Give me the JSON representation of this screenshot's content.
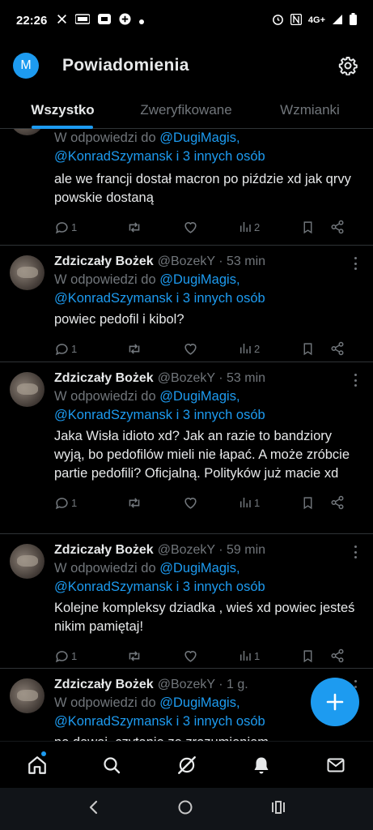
{
  "status_bar": {
    "time": "22:26",
    "left_icons": [
      "x-icon",
      "vodafone-icon",
      "app-icon",
      "game-icon",
      "dot-icon"
    ],
    "network": "4G+"
  },
  "header": {
    "avatar_letter": "M",
    "title": "Powiadomienia"
  },
  "tabs": [
    {
      "label": "Wszystko",
      "active": true
    },
    {
      "label": "Zweryfikowane",
      "active": false
    },
    {
      "label": "Wzmianki",
      "active": false
    }
  ],
  "posts": [
    {
      "name": "",
      "handle": "",
      "time": "",
      "reply_prefix": "W odpowiedzi do",
      "mention1": "@DugiMagis,",
      "mention2": "@KonradSzymansk i 3 innych osób",
      "text": "ale we francji dostał macron po piździe xd jak qrvy powskie dostaną",
      "replies": "1",
      "retweets": "",
      "likes": "",
      "views": "2"
    },
    {
      "name": "Zdziczały Bożek",
      "handle": "@BozekY · 53 min",
      "reply_prefix": "W odpowiedzi do",
      "mention1": "@DugiMagis,",
      "mention2": "@KonradSzymansk i 3 innych osób",
      "text": "powiec pedofil i kibol?",
      "replies": "1",
      "retweets": "",
      "likes": "",
      "views": "2"
    },
    {
      "name": "Zdziczały Bożek",
      "handle": "@BozekY · 53 min",
      "reply_prefix": "W odpowiedzi do",
      "mention1": "@DugiMagis,",
      "mention2": "@KonradSzymansk i 3 innych osób",
      "text": "Jaka Wisła idioto xd? Jak an razie to bandziory wyją, bo pedofilów mieli nie łapać. A może zróbcie partie pedofili? Oficjalną. Polityków już macie xd",
      "replies": "1",
      "retweets": "",
      "likes": "",
      "views": "1"
    },
    {
      "name": "Zdziczały Bożek",
      "handle": "@BozekY · 59 min",
      "reply_prefix": "W odpowiedzi do",
      "mention1": "@DugiMagis,",
      "mention2": "@KonradSzymansk i 3 innych osób",
      "text": "Kolejne kompleksy dziadka , wieś xd powiec jesteś nikim pamiętaj!",
      "replies": "1",
      "retweets": "",
      "likes": "",
      "views": "1"
    },
    {
      "name": "Zdziczały Bożek",
      "handle": "@BozekY · 1 g.",
      "reply_prefix": "W odpowiedzi do",
      "mention1": "@DugiMagis,",
      "mention2": "@KonradSzymansk i 3 innych osób",
      "text": "no dawaj, czytanie ze zrozumieniem",
      "replies": "",
      "retweets": "",
      "likes": "",
      "views": ""
    }
  ],
  "bottom_nav": [
    "home-icon",
    "search-icon",
    "grok-icon",
    "notifications-icon",
    "messages-icon"
  ],
  "colors": {
    "accent": "#1d9bf0",
    "background": "#000000",
    "muted": "#71767b",
    "text": "#e7e9ea"
  }
}
